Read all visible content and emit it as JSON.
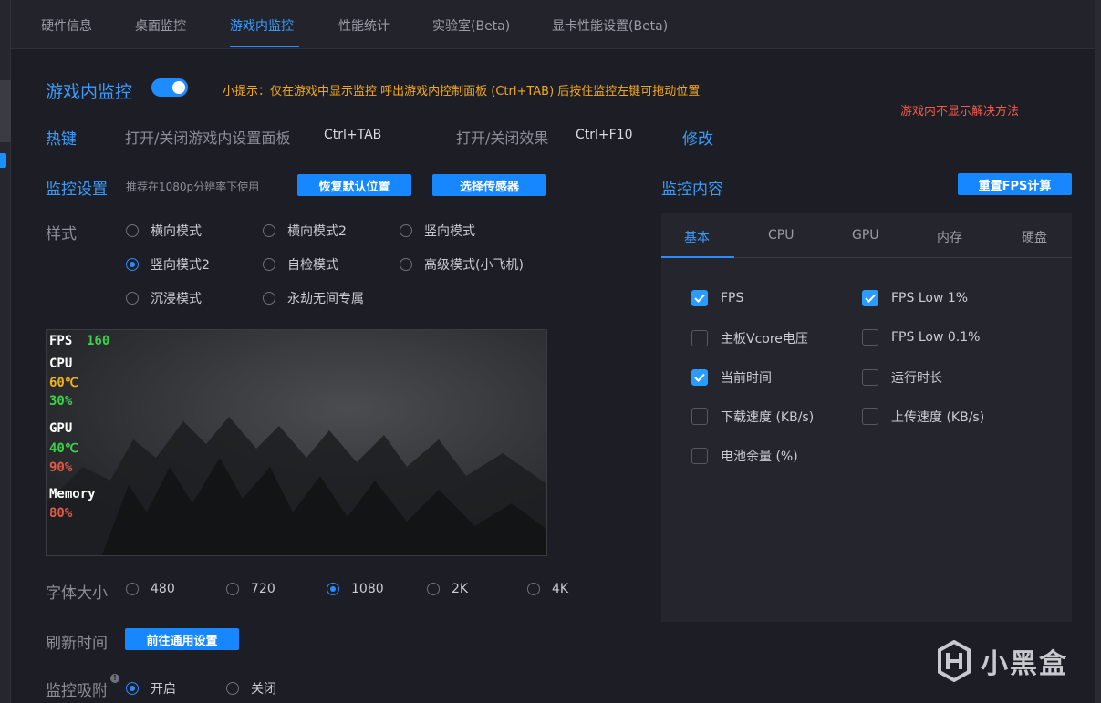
{
  "tabs": [
    "硬件信息",
    "桌面监控",
    "游戏内监控",
    "性能统计",
    "实验室(Beta)",
    "显卡性能设置(Beta)"
  ],
  "active_tab": "游戏内监控",
  "header": {
    "title": "游戏内监控",
    "toggle_on": true,
    "tip": "小提示：仅在游戏中显示监控 呼出游戏内控制面板 (Ctrl+TAB) 后按住监控左键可拖动位置",
    "help_link": "游戏内不显示解决方法"
  },
  "hotkey": {
    "label": "热键",
    "item1_label": "打开/关闭游戏内设置面板",
    "item1_key": "Ctrl+TAB",
    "item2_label": "打开/关闭效果",
    "item2_key": "Ctrl+F10",
    "edit": "修改"
  },
  "monitor_settings": {
    "label": "监控设置",
    "hint": "推荐在1080p分辨率下使用",
    "reset_button": "恢复默认位置",
    "sensor_button": "选择传感器"
  },
  "style": {
    "label": "样式",
    "options": [
      "横向模式",
      "横向模式2",
      "竖向模式",
      "竖向模式2",
      "自检模式",
      "高级模式(小飞机)",
      "沉浸模式",
      "永劫无间专属"
    ],
    "selected": "竖向模式2"
  },
  "preview_osd": {
    "fps_label": "FPS",
    "fps_value": "160",
    "cpu_label": "CPU",
    "cpu_temp": "60℃",
    "cpu_usage": "30%",
    "gpu_label": "GPU",
    "gpu_temp": "40℃",
    "gpu_usage": "90%",
    "mem_label": "Memory",
    "mem_usage": "80%",
    "colors": {
      "fps": "#3fd04a",
      "cpu_temp": "#f2b21b",
      "green": "#3fd04a",
      "red": "#e05b43"
    }
  },
  "font_size": {
    "label": "字体大小",
    "options": [
      "480",
      "720",
      "1080",
      "2K",
      "4K"
    ],
    "selected": "1080"
  },
  "refresh": {
    "label": "刷新时间",
    "button": "前往通用设置"
  },
  "snap": {
    "label": "监控吸附",
    "options": [
      "开启",
      "关闭"
    ],
    "selected": "开启"
  },
  "content": {
    "label": "监控内容",
    "reset_fps_button": "重置FPS计算",
    "tabs": [
      "基本",
      "CPU",
      "GPU",
      "内存",
      "硬盘"
    ],
    "active_tab": "基本",
    "items": [
      {
        "label": "FPS",
        "checked": true
      },
      {
        "label": "FPS Low 1%",
        "checked": true
      },
      {
        "label": "主板Vcore电压",
        "checked": false
      },
      {
        "label": "FPS Low 0.1%",
        "checked": false
      },
      {
        "label": "当前时间",
        "checked": true
      },
      {
        "label": "运行时长",
        "checked": false
      },
      {
        "label": "下载速度 (KB/s)",
        "checked": false
      },
      {
        "label": "上传速度 (KB/s)",
        "checked": false
      },
      {
        "label": "电池余量 (%)",
        "checked": false
      }
    ]
  },
  "watermark": "小黑盒",
  "accent_color": "#1787ff"
}
